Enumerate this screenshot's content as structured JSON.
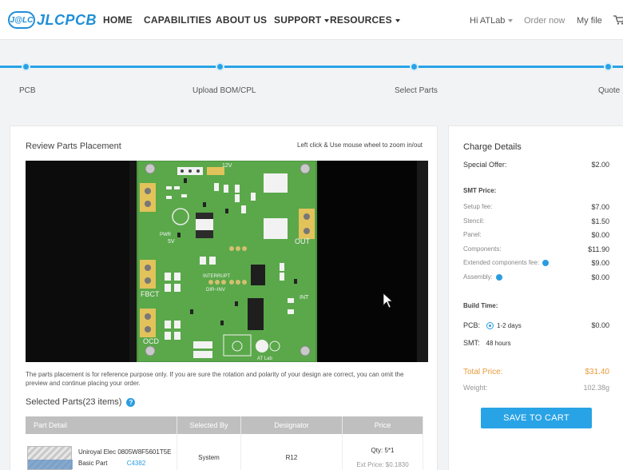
{
  "nav": {
    "logo_badge": "J@LC",
    "logo_text": "JLCPCB",
    "items": [
      "HOME",
      "CAPABILITIES",
      "ABOUT US",
      "SUPPORT",
      "RESOURCES"
    ],
    "greeting": "Hi ATLab",
    "order_now": "Order now",
    "my_file": "My file"
  },
  "steps": [
    "PCB",
    "Upload BOM/CPL",
    "Select Parts",
    "Quote"
  ],
  "review": {
    "title": "Review Parts Placement",
    "hint": "Left click & Use mouse wheel to zoom in/out",
    "note": "The parts placement is for reference purpose only. If you are sure the rotation and polarity of your design are correct, you can omit the preview and continue placing your order.",
    "board_labels": {
      "v12": "12V",
      "out": "OUT",
      "fbct": "FBCT",
      "ocd": "OCD",
      "pwr": "PWR",
      "v5": "5V",
      "interrupt": "INTERRUPT",
      "dir_inv": "DIR~INV",
      "int": "INT",
      "atlab": "AT Lab"
    }
  },
  "selected_parts": {
    "title": "Selected Parts(23 items)",
    "columns": [
      "Part Detail",
      "Selected By",
      "Designator",
      "Price"
    ],
    "rows": [
      {
        "name": "Uniroyal Elec 0805W8F5601T5E",
        "type": "Basic Part",
        "code": "C4382",
        "selected_by": "System",
        "designator": "R12",
        "qty": "Qty: 5*1",
        "ext": "Ext Price: $0.1830"
      }
    ]
  },
  "charge": {
    "title": "Charge Details",
    "special_offer": {
      "label": "Special Offer:",
      "value": "$2.00"
    },
    "smt_price_label": "SMT Price:",
    "smt_items": [
      {
        "label": "Setup fee:",
        "value": "$7.00"
      },
      {
        "label": "Stencil:",
        "value": "$1.50"
      },
      {
        "label": "Panel:",
        "value": "$0.00"
      },
      {
        "label": "Components:",
        "value": "$11.90"
      },
      {
        "label": "Extended components fee:",
        "value": "$9.00"
      },
      {
        "label": "Assembly:",
        "value": "$0.00"
      }
    ],
    "build_time_label": "Build Time:",
    "pcb_label": "PCB:",
    "pcb_option": "1-2 days",
    "pcb_value": "$0.00",
    "smt_label": "SMT:",
    "smt_hours": "48 hours",
    "total_label": "Total Price:",
    "total_value": "$31.40",
    "weight_label": "Weight:",
    "weight_value": "102.38g",
    "button": "SAVE TO CART"
  },
  "colors": {
    "accent": "#28a3e6",
    "total": "#e89a3c",
    "pcb_green": "#5aa84a"
  }
}
